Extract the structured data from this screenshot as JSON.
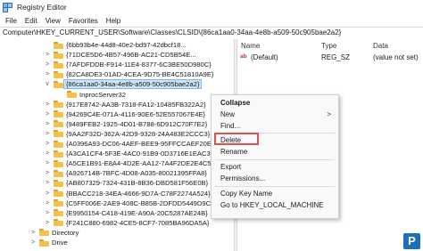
{
  "window": {
    "title": "Registry Editor"
  },
  "menu": [
    "File",
    "Edit",
    "View",
    "Favorites",
    "Help"
  ],
  "address": "Computer\\HKEY_CURRENT_USER\\Software\\Classes\\CLSID\\{86ca1aa0-34aa-4e8b-a509-50c905bae2a2}",
  "tree": {
    "items": [
      {
        "label": "{6bb93b4e-44d8-40e2-bd97-42dbcf18...",
        "expander": "",
        "indent": 0
      },
      {
        "label": "{71DCE5D6-4B57-496B-AC21-CD5B54E...",
        "expander": ">",
        "indent": 0
      },
      {
        "label": "{7AFDFDDB-F914-11E4-8377-6C3BE50D980C}",
        "expander": ">",
        "indent": 0
      },
      {
        "label": "{82CA8DE3-01AD-4CEA-9D75-BE4C51810A9E}",
        "expander": ">",
        "indent": 0
      },
      {
        "label": "{86ca1aa0-34aa-4e8b-a509-50c905bae2a2}",
        "expander": "v",
        "indent": 0,
        "selected": true
      },
      {
        "label": "InprocServer32",
        "expander": "",
        "indent": 1
      },
      {
        "label": "{917E8742-AA3B-7318-FA12-10485FB322A2}",
        "expander": ">",
        "indent": 0
      },
      {
        "label": "{94269C4E-071A-4116-90E6-52E557067E4E}",
        "expander": ">",
        "indent": 0
      },
      {
        "label": "{9489FEB2-1925-4D01-B788-6D912C70F7E2}",
        "expander": ">",
        "indent": 0
      },
      {
        "label": "{9AA2F32D-362A-42D9-9328-24A483E2CCC3}",
        "expander": ">",
        "indent": 0
      },
      {
        "label": "{A0396A93-DC06-4AEF-BEE9-95FFCCAEF20E}",
        "expander": ">",
        "indent": 0
      },
      {
        "label": "{A3CA1CF4-5F3E-4AC0-91B9-0D3716E1EAC3}",
        "expander": ">",
        "indent": 0
      },
      {
        "label": "{A5CE1B91-E8A4-4D2E-AA12-7A4F2DE2E4C5}",
        "expander": ">",
        "indent": 0
      },
      {
        "label": "{A926714B-7BFC-4D08-A035-80021395FFA8}",
        "expander": ">",
        "indent": 0
      },
      {
        "label": "{AB807329-7324-431B-8B36-DBD581F56E0B}",
        "expander": ">",
        "indent": 0
      },
      {
        "label": "{BBACC218-34EA-4666-9D7A-C78F2274A524}",
        "expander": ">",
        "indent": 0
      },
      {
        "label": "{C5FF006E-2AE9-408C-B85B-2DFDD5449D9C}",
        "expander": ">",
        "indent": 0
      },
      {
        "label": "{E9950154-C418-419E-A90A-20C5287AE24B}",
        "expander": ">",
        "indent": 0
      },
      {
        "label": "{F241C880-6982-4CE5-8CF7-7085BA96DA5A}",
        "expander": ">",
        "indent": 0
      },
      {
        "label": "Directory",
        "expander": ">",
        "indent": -1
      },
      {
        "label": "Drive",
        "expander": ">",
        "indent": -1
      }
    ]
  },
  "values": {
    "headers": {
      "name": "Name",
      "type": "Type",
      "data": "Data"
    },
    "rows": [
      {
        "name": "(Default)",
        "type": "REG_SZ",
        "data": "(value not set)"
      }
    ]
  },
  "context_menu": {
    "collapse": "Collapse",
    "new": "New",
    "new_arrow": ">",
    "find": "Find...",
    "delete": "Delete",
    "rename": "Rename",
    "export": "Export",
    "permissions": "Permissions...",
    "copy_key_name": "Copy Key Name",
    "goto": "Go to HKEY_LOCAL_MACHINE"
  },
  "watermark": {
    "text": "P",
    "color": "#1d6fb8"
  },
  "colors": {
    "selection": "#cce4f7",
    "highlight_box": "#d9534f",
    "folder": "#f2c24a"
  }
}
